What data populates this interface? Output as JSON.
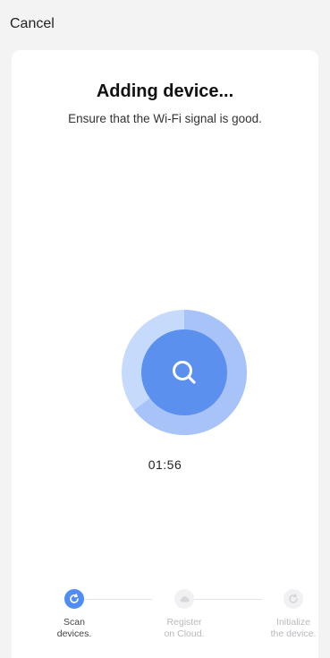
{
  "topbar": {
    "cancel_label": "Cancel"
  },
  "main": {
    "title": "Adding device...",
    "subtitle": "Ensure that the Wi-Fi signal is good.",
    "timer": "01:56",
    "search_icon": "search-icon",
    "colors": {
      "accent": "#4f8df4",
      "ring_outer": "#c3d7fb",
      "ring_mid": "#9fbef8"
    }
  },
  "steps": [
    {
      "label": "Scan\ndevices.",
      "icon": "refresh-icon",
      "state": "active"
    },
    {
      "label": "Register\non Cloud.",
      "icon": "cloud-icon",
      "state": "inactive"
    },
    {
      "label": "Initialize\nthe device.",
      "icon": "refresh-icon",
      "state": "inactive"
    }
  ]
}
